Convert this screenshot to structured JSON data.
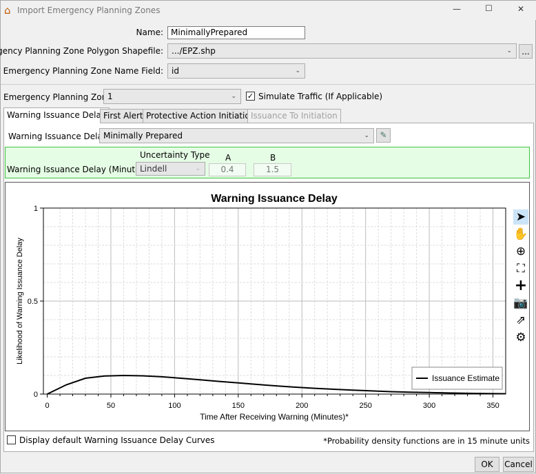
{
  "window": {
    "title": "Import Emergency Planning Zones",
    "minimize": "—",
    "maximize": "☐",
    "close": "✕"
  },
  "form": {
    "name_label": "Name:",
    "name_value": "MinimallyPrepared",
    "shapefile_label": "Emergency Planning Zone Polygon Shapefile:",
    "shapefile_value": ".../EPZ.shp",
    "browse_label": "...",
    "name_field_label": "Emergency Planning Zone Name Field:",
    "name_field_value": "id"
  },
  "zone": {
    "label": "Emergency Planning Zone:",
    "value": "1",
    "simulate_label": "Simulate Traffic (If Applicable)",
    "simulate_checked": true
  },
  "tabs": [
    {
      "label": "Warning Issuance Delay"
    },
    {
      "label": "First Alert"
    },
    {
      "label": "Protective Action Initiation"
    },
    {
      "label": "Issuance To Initiation"
    }
  ],
  "delay": {
    "label": "Warning Issuance Delay:",
    "value": "Minimally Prepared",
    "minutes_label": "Warning Issuance Delay (Minutes):",
    "uncertainty_header": "Uncertainty Type",
    "uncertainty_value": "Lindell",
    "a_header": "A",
    "a_value": "0.4",
    "b_header": "B",
    "b_value": "1.5"
  },
  "chart_data": {
    "type": "line",
    "title": "Warning Issuance Delay",
    "xlabel": "Time After Receiving Warning (Minutes)*",
    "ylabel": "Likelihood of Warning Issuance Delay",
    "xlim": [
      -3,
      360
    ],
    "ylim": [
      0,
      1
    ],
    "xticks": [
      "0",
      "50",
      "100",
      "150",
      "200",
      "250",
      "300",
      "350"
    ],
    "yticks": [
      "0",
      "0.5",
      "1"
    ],
    "grid": true,
    "legend_position": "bottom-right",
    "series": [
      {
        "name": "Issuance Estimate",
        "color": "#000000",
        "x": [
          0,
          15,
          30,
          45,
          60,
          75,
          90,
          105,
          120,
          135,
          150,
          165,
          180,
          195,
          210,
          225,
          240,
          255,
          270,
          285,
          300,
          315,
          330,
          345,
          360
        ],
        "y": [
          0,
          0.05,
          0.085,
          0.097,
          0.1,
          0.098,
          0.093,
          0.085,
          0.077,
          0.068,
          0.06,
          0.052,
          0.044,
          0.037,
          0.031,
          0.026,
          0.021,
          0.017,
          0.013,
          0.01,
          0.008,
          0.006,
          0.004,
          0.003,
          0.002
        ]
      }
    ]
  },
  "toolbar": [
    "pointer-icon",
    "pan-icon",
    "zoom-icon",
    "fit-icon",
    "add-icon",
    "camera-icon",
    "export-icon",
    "settings-icon"
  ],
  "footer": {
    "default_curves_label": "Display default Warning Issuance Delay Curves",
    "note": "*Probability density functions are in 15 minute units",
    "ok": "OK",
    "cancel": "Cancel"
  }
}
